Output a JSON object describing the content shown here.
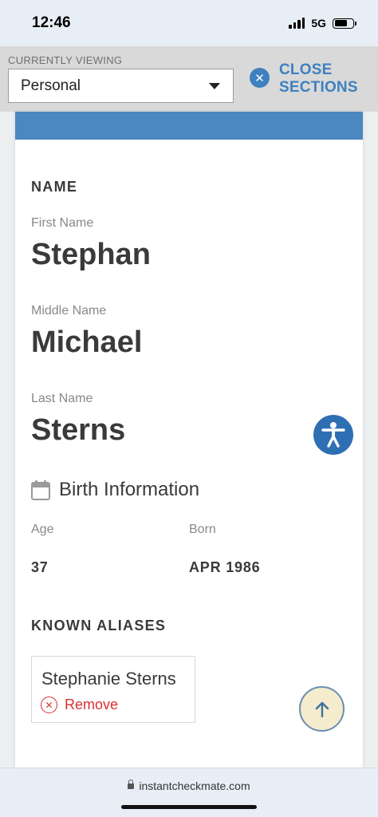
{
  "status_bar": {
    "time": "12:46",
    "network": "5G",
    "signal_bars": 4,
    "battery_level": 0.72
  },
  "header": {
    "currently_viewing_label": "CURRENTLY VIEWING",
    "selected_section": "Personal",
    "close_sections_line1": "CLOSE",
    "close_sections_line2": "SECTIONS",
    "accent_color": "#3f80bf"
  },
  "name_section": {
    "heading": "NAME",
    "first_name_label": "First Name",
    "first_name": "Stephan",
    "middle_name_label": "Middle Name",
    "middle_name": "Michael",
    "last_name_label": "Last Name",
    "last_name": "Sterns"
  },
  "birth_section": {
    "icon": "calendar-icon",
    "title": "Birth Information",
    "age_label": "Age",
    "age": "37",
    "born_label": "Born",
    "born": "APR 1986"
  },
  "aliases_section": {
    "heading": "KNOWN ALIASES",
    "aliases": [
      {
        "name": "Stephanie Sterns",
        "remove_label": "Remove"
      }
    ]
  },
  "browser": {
    "url": "instantcheckmate.com"
  },
  "floating": {
    "accessibility_icon": "accessibility-icon",
    "scroll_top_icon": "arrow-up-icon"
  }
}
